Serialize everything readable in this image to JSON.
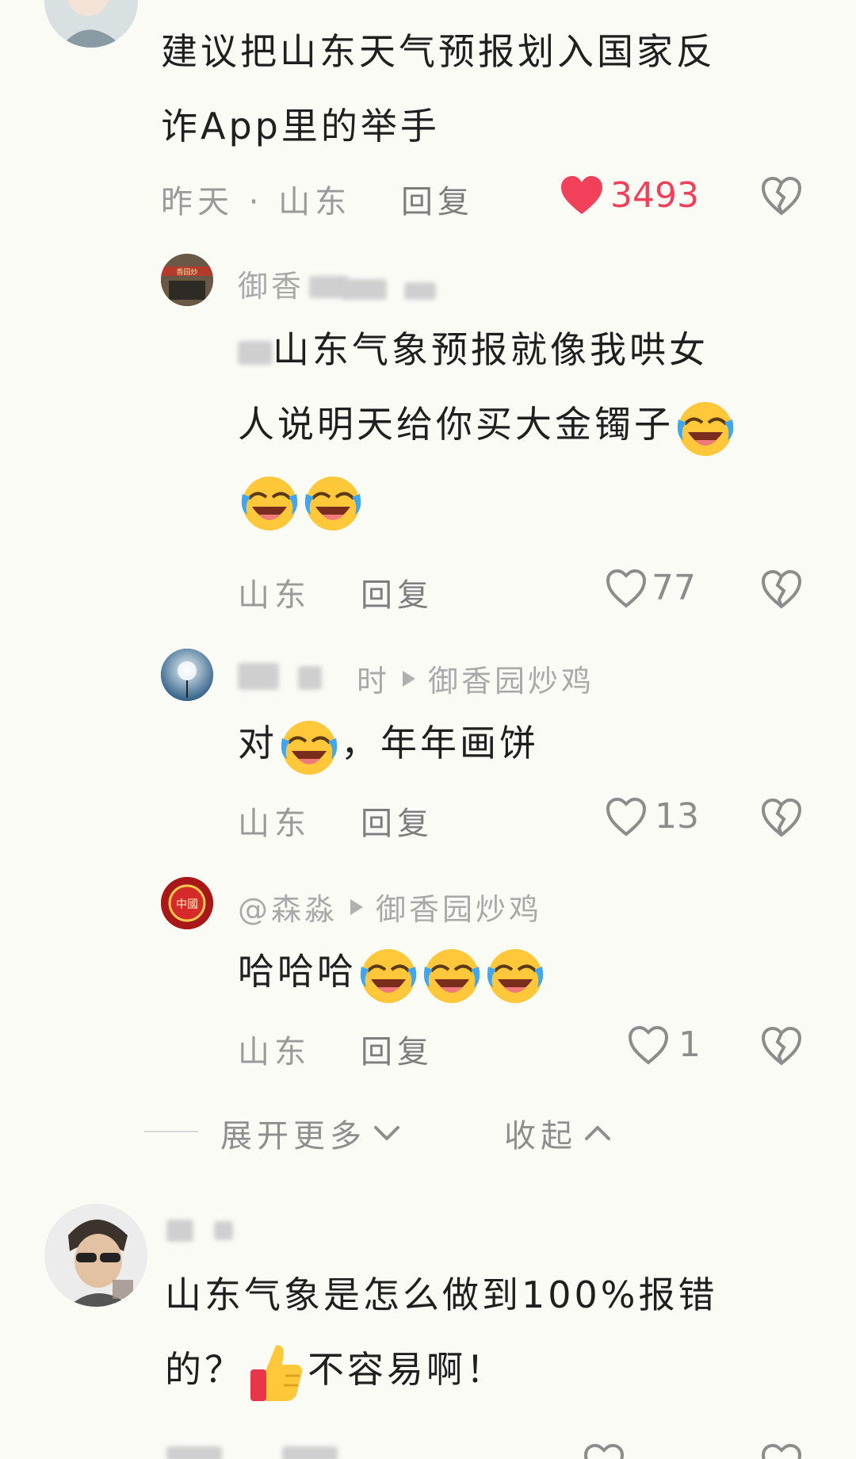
{
  "comment1": {
    "text_line1": "建议把山东天气预报划入国家反",
    "text_line2": "诈App里的举手",
    "time": "昨天",
    "location": "山东",
    "reply": "回复",
    "likes": "3493",
    "liked": true
  },
  "reply1": {
    "name": "御香",
    "text_line1": "山东气象预报就像我哄女",
    "text_line2": "人说明天给你买大金镯子",
    "location": "山东",
    "reply": "回复",
    "likes": "77",
    "avatar_text": "香园炒"
  },
  "reply2": {
    "name_suffix": "时",
    "reply_to": "御香园炒鸡",
    "text_a": "对",
    "text_b": "，年年画饼",
    "location": "山东",
    "reply": "回复",
    "likes": "13"
  },
  "reply3": {
    "name": "@森淼",
    "reply_to": "御香园炒鸡",
    "text": "哈哈哈",
    "location": "山东",
    "reply": "回复",
    "likes": "1",
    "avatar_text": "中國"
  },
  "thread_controls": {
    "expand": "展开更多",
    "collapse": "收起"
  },
  "comment2": {
    "text_line1": "山东气象是怎么做到100%报错",
    "text_line2_a": "的？",
    "text_line2_b": "不容易啊！"
  },
  "colors": {
    "like_red": "#f0405a",
    "meta_gray": "#9a9a9a",
    "background": "#fbfbf6"
  }
}
